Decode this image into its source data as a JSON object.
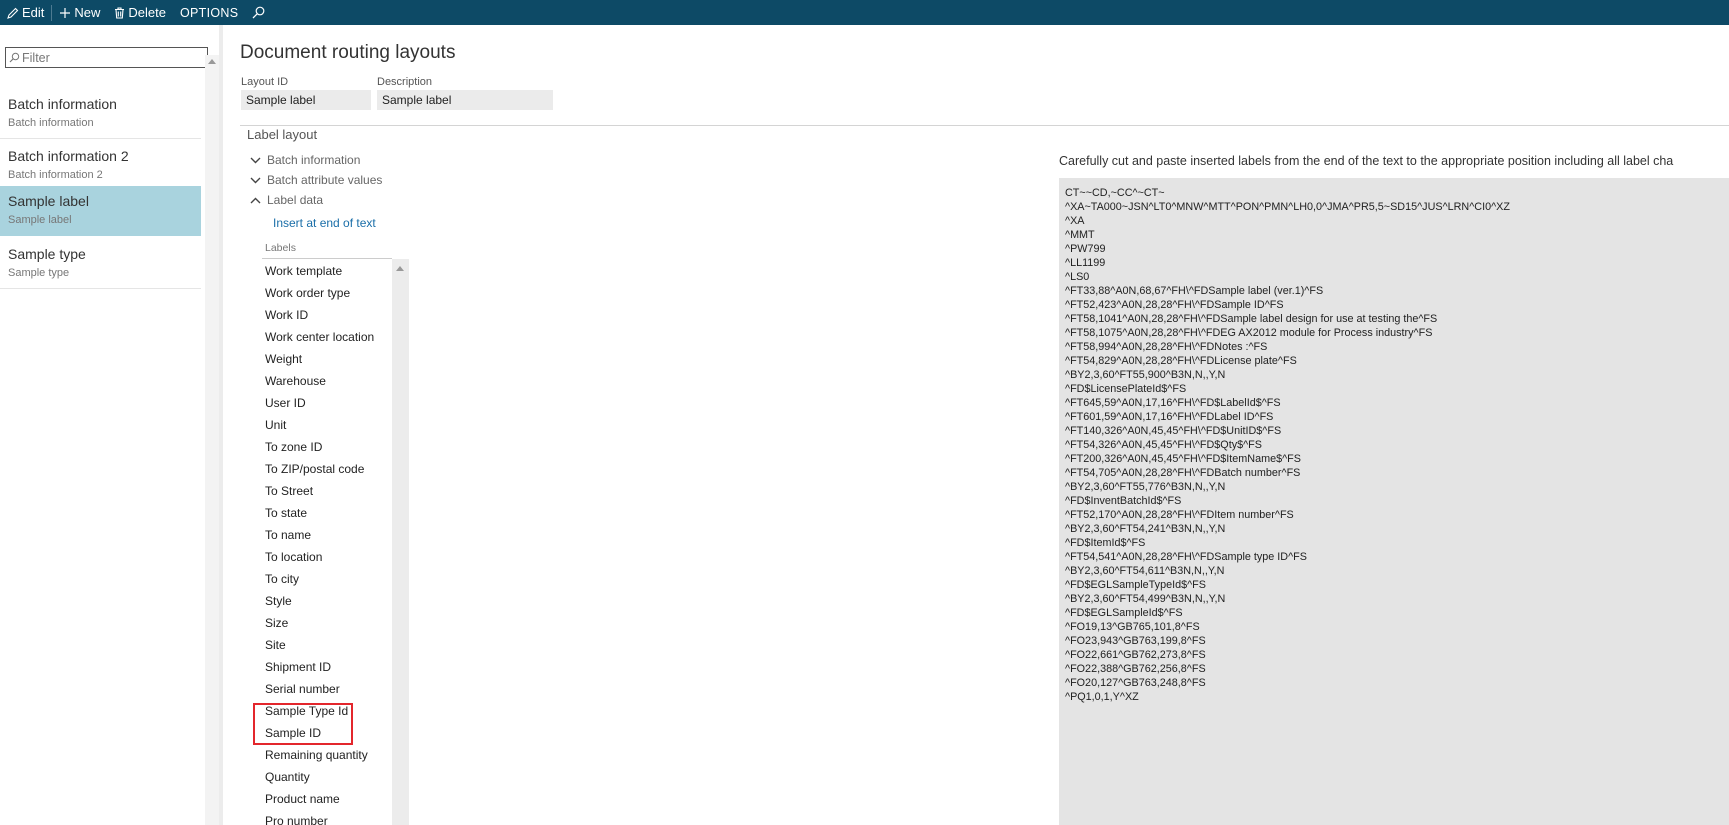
{
  "toolbar": {
    "edit_label": "Edit",
    "new_label": "New",
    "delete_label": "Delete",
    "options_label": "OPTIONS",
    "icons": [
      "edit-icon",
      "plus-icon",
      "trash-icon",
      "search-icon"
    ]
  },
  "left_pane": {
    "filter_placeholder": "Filter",
    "items": [
      {
        "title": "Batch information",
        "subtitle": "Batch information"
      },
      {
        "title": "Batch information 2",
        "subtitle": "Batch information 2"
      },
      {
        "title": "Sample label",
        "subtitle": "Sample label"
      },
      {
        "title": "Sample type",
        "subtitle": "Sample type"
      }
    ],
    "selected_item": "Sample label"
  },
  "main": {
    "page_title": "Document routing layouts",
    "layout_id_label": "Layout ID",
    "layout_id_value": "Sample label",
    "description_label": "Description",
    "description_value": "Sample label",
    "section_title": "Label layout",
    "groups": [
      {
        "label": "Batch information",
        "state": "collapsed"
      },
      {
        "label": "Batch attribute values",
        "state": "collapsed"
      },
      {
        "label": "Label data",
        "state": "expanded"
      }
    ],
    "insert_link": "Insert at end of text",
    "labels_header": "Labels",
    "labels": [
      "Work template",
      "Work order type",
      "Work ID",
      "Work center location",
      "Weight",
      "Warehouse",
      "User ID",
      "Unit",
      "To zone ID",
      "To ZIP/postal code",
      "To Street",
      "To state",
      "To name",
      "To location",
      "To city",
      "Style",
      "Size",
      "Site",
      "Shipment ID",
      "Serial number",
      "Sample Type Id",
      "Sample ID",
      "Remaining quantity",
      "Quantity",
      "Product name",
      "Pro number"
    ],
    "highlight_color": "#e3262c",
    "instruction": "Carefully cut and paste inserted labels from the end of the text to the appropriate position including all label cha",
    "code_lines": [
      "CT~~CD,~CC^~CT~",
      "^XA~TA000~JSN^LT0^MNW^MTT^PON^PMN^LH0,0^JMA^PR5,5~SD15^JUS^LRN^CI0^XZ",
      "^XA",
      "^MMT",
      "^PW799",
      "^LL1199",
      "^LS0",
      "^FT33,88^A0N,68,67^FH\\^FDSample label (ver.1)^FS",
      "^FT52,423^A0N,28,28^FH\\^FDSample ID^FS",
      "^FT58,1041^A0N,28,28^FH\\^FDSample label design for use at testing the^FS",
      "^FT58,1075^A0N,28,28^FH\\^FDEG AX2012 module for Process industry^FS",
      "^FT58,994^A0N,28,28^FH\\^FDNotes :^FS",
      "^FT54,829^A0N,28,28^FH\\^FDLicense plate^FS",
      "^BY2,3,60^FT55,900^B3N,N,,Y,N",
      "^FD$LicensePlateId$^FS",
      "^FT645,59^A0N,17,16^FH\\^FD$LabelId$^FS",
      "^FT601,59^A0N,17,16^FH\\^FDLabel ID^FS",
      "^FT140,326^A0N,45,45^FH\\^FD$UnitID$^FS",
      "^FT54,326^A0N,45,45^FH\\^FD$Qty$^FS",
      "^FT200,326^A0N,45,45^FH\\^FD$ItemName$^FS",
      "^FT54,705^A0N,28,28^FH\\^FDBatch number^FS",
      "^BY2,3,60^FT55,776^B3N,N,,Y,N",
      "^FD$InventBatchId$^FS",
      "^FT52,170^A0N,28,28^FH\\^FDItem number^FS",
      "^BY2,3,60^FT54,241^B3N,N,,Y,N",
      "^FD$ItemId$^FS",
      "^FT54,541^A0N,28,28^FH\\^FDSample type ID^FS",
      "^BY2,3,60^FT54,611^B3N,N,,Y,N",
      "^FD$EGLSampleTypeId$^FS",
      "^BY2,3,60^FT54,499^B3N,N,,Y,N",
      "^FD$EGLSampleId$^FS",
      "^FO19,13^GB765,101,8^FS",
      "^FO23,943^GB763,199,8^FS",
      "^FO22,661^GB762,273,8^FS",
      "^FO22,388^GB762,256,8^FS",
      "^FO20,127^GB763,248,8^FS",
      "^PQ1,0,1,Y^XZ"
    ]
  }
}
